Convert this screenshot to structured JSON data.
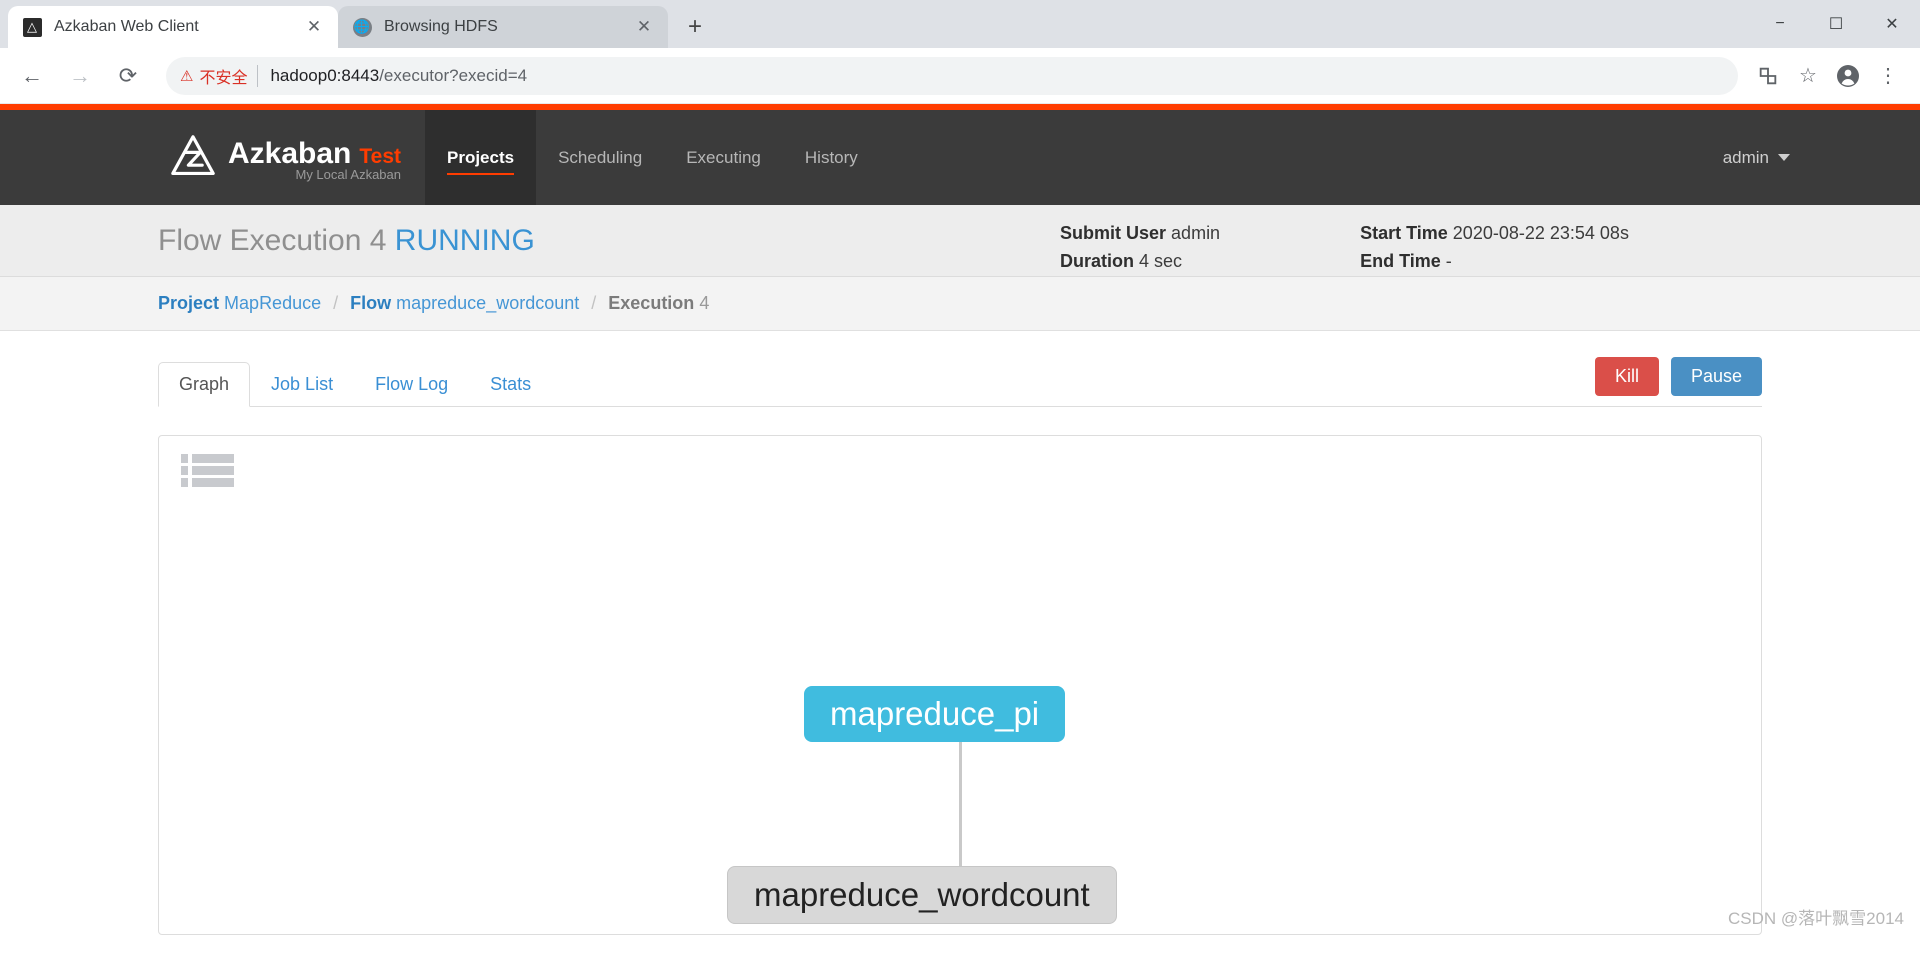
{
  "browser": {
    "tabs": [
      {
        "title": "Azkaban Web Client",
        "favicon": "azkaban-icon",
        "active": true,
        "close_label": "✕"
      },
      {
        "title": "Browsing HDFS",
        "favicon": "globe-icon",
        "active": false,
        "close_label": "✕"
      }
    ],
    "new_tab_label": "+",
    "window_controls": {
      "minimize": "−",
      "maximize": "☐",
      "close": "✕"
    },
    "nav": {
      "back": "←",
      "forward": "→",
      "reload": "⟳"
    },
    "omnibox": {
      "warning_icon": "⚠",
      "warning_text": "不安全",
      "url_host": "hadoop0:8443",
      "url_rest": "/executor?execid=4"
    },
    "toolbar_icons": {
      "translate": "translate-icon",
      "bookmark": "☆",
      "profile": "profile-icon",
      "menu": "⋮"
    }
  },
  "azkaban": {
    "brand": {
      "name": "Azkaban",
      "tag": "Test",
      "subtitle": "My Local Azkaban"
    },
    "nav_items": [
      {
        "label": "Projects",
        "active": true
      },
      {
        "label": "Scheduling",
        "active": false
      },
      {
        "label": "Executing",
        "active": false
      },
      {
        "label": "History",
        "active": false
      }
    ],
    "user": {
      "name": "admin"
    },
    "execution": {
      "title_prefix": "Flow Execution 4",
      "status": "RUNNING",
      "meta": [
        {
          "label": "Submit User",
          "value": "admin"
        },
        {
          "label": "Duration",
          "value": "4 sec"
        },
        {
          "label": "Start Time",
          "value": "2020-08-22 23:54 08s"
        },
        {
          "label": "End Time",
          "value": "-"
        }
      ]
    },
    "breadcrumb": {
      "project_label": "Project",
      "project_value": "MapReduce",
      "flow_label": "Flow",
      "flow_value": "mapreduce_wordcount",
      "execution_label": "Execution",
      "execution_value": "4",
      "separator": "/"
    },
    "tabs": [
      {
        "label": "Graph",
        "active": true
      },
      {
        "label": "Job List",
        "active": false
      },
      {
        "label": "Flow Log",
        "active": false
      },
      {
        "label": "Stats",
        "active": false
      }
    ],
    "actions": [
      {
        "label": "Kill",
        "color": "#da4f49"
      },
      {
        "label": "Pause",
        "color": "#4a90c4"
      }
    ],
    "graph": {
      "toggle_icon": "list-view-icon",
      "nodes": [
        {
          "label": "mapreduce_pi",
          "state": "running",
          "color": "#40bcdf"
        },
        {
          "label": "mapreduce_wordcount",
          "state": "ready",
          "color": "#d8d8d8"
        }
      ]
    }
  },
  "watermark": {
    "text": "CSDN @落叶飘雪2014"
  }
}
